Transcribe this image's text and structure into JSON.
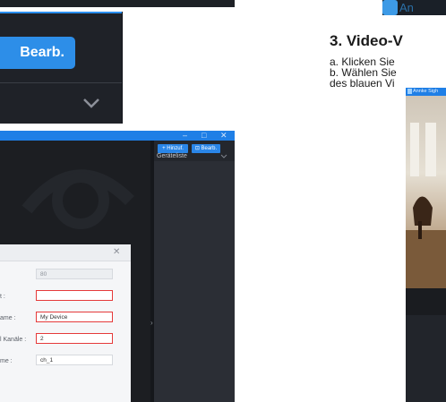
{
  "top_left_crop": {
    "edit_button_label": "Bearb."
  },
  "app_window": {
    "buttons": {
      "add_label": "+ Hinzuf.",
      "edit_label": "⊡ Bearb."
    },
    "window_controls": [
      "–",
      "□",
      "✕"
    ],
    "device_list_label": "Geräteliste",
    "dialog": {
      "fields": [
        {
          "label": "",
          "value": "80",
          "state": "disabled"
        },
        {
          "label": "t :",
          "value": "",
          "state": "error"
        },
        {
          "label": "ame :",
          "value": "My Device",
          "state": "error"
        },
        {
          "label": "l Kanäle :",
          "value": "2",
          "state": "error"
        },
        {
          "label": "me :",
          "value": "ch_1",
          "state": "normal"
        }
      ]
    }
  },
  "right_column": {
    "app_logo_text": "An",
    "section_title": "3. Video-V",
    "paragraphs": [
      "a. Klicken Sie",
      "b. Wählen Sie",
      "des blauen Vi"
    ],
    "video_window_title": "Annke Sigh"
  },
  "colors": {
    "accent_blue": "#2d8ee8",
    "error_red": "#e53a3a",
    "dark_bg": "#1f2228"
  }
}
